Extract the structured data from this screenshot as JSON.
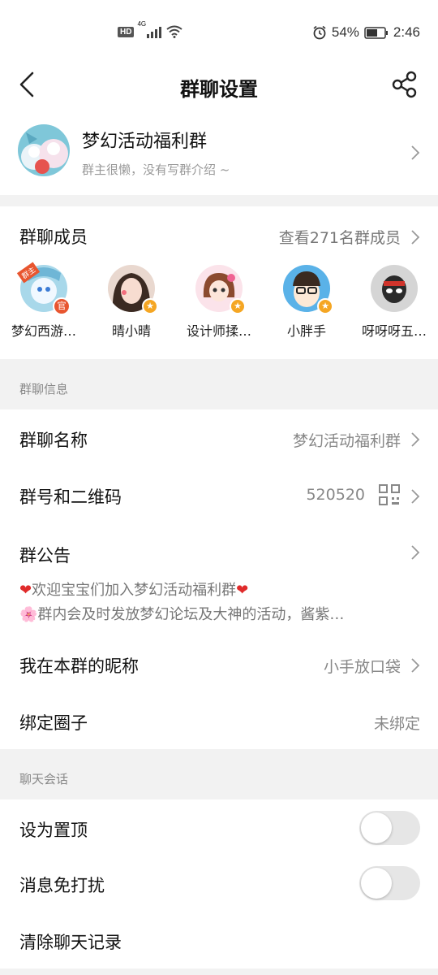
{
  "status_bar": {
    "hd": "HD",
    "net": "4G",
    "battery": "54%",
    "time": "2:46"
  },
  "nav": {
    "title": "群聊设置"
  },
  "group": {
    "name": "梦幻活动福利群",
    "description": "群主很懒，没有写群介绍 ~"
  },
  "members": {
    "title": "群聊成员",
    "view_all": "查看271名群成员",
    "list": [
      {
        "name": "梦幻西游…",
        "badge": "官",
        "tag": "群主"
      },
      {
        "name": "晴小晴",
        "badge": "★"
      },
      {
        "name": "设计师揉…",
        "badge": "★"
      },
      {
        "name": "小胖手",
        "badge": "★"
      },
      {
        "name": "呀呀呀五…"
      }
    ]
  },
  "group_info": {
    "header": "群聊信息",
    "name_label": "群聊名称",
    "name_value": "梦幻活动福利群",
    "number_label": "群号和二维码",
    "number_value": "520520",
    "notice_label": "群公告",
    "notice_line1_prefix": "❤",
    "notice_line1": "欢迎宝宝们加入梦幻活动福利群",
    "notice_line1_suffix": "❤",
    "notice_line2_prefix": "🌸",
    "notice_line2": "群内会及时发放梦幻论坛及大神的活动，酱紫…",
    "nickname_label": "我在本群的昵称",
    "nickname_value": "小手放口袋",
    "circle_label": "绑定圈子",
    "circle_value": "未绑定"
  },
  "chat": {
    "header": "聊天会话",
    "pin_label": "设为置顶",
    "pin_on": false,
    "mute_label": "消息免打扰",
    "mute_on": false,
    "clear_label": "清除聊天记录"
  }
}
